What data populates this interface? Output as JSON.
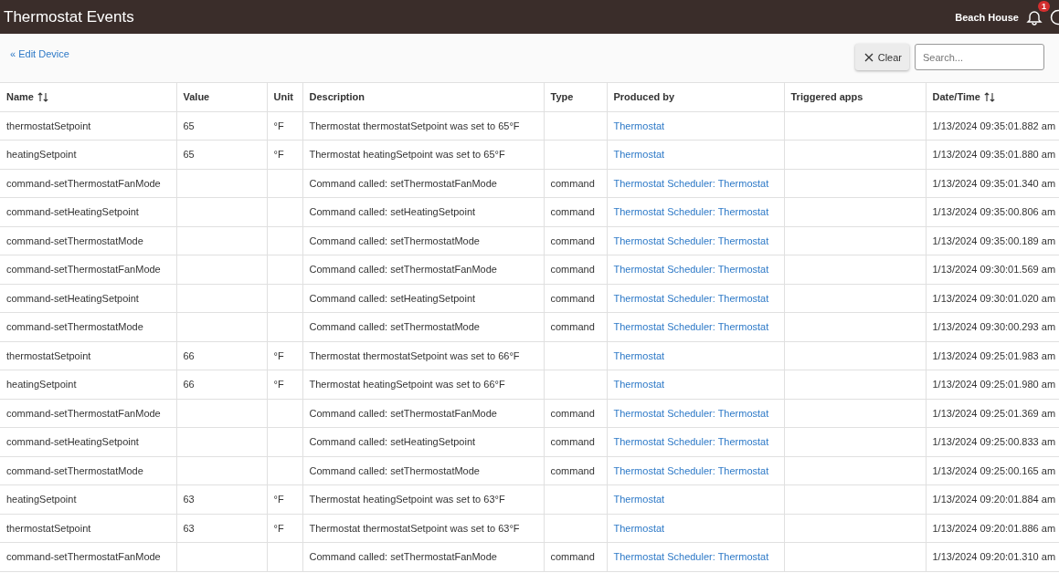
{
  "header": {
    "title": "Thermostat Events",
    "location": "Beach House",
    "notification_count": "1"
  },
  "toolbar": {
    "back_link": "« Edit Device",
    "clear_button": "Clear",
    "search": {
      "placeholder": "Search..."
    }
  },
  "table": {
    "columns": [
      {
        "label": "Name",
        "sortable": true
      },
      {
        "label": "Value",
        "sortable": false
      },
      {
        "label": "Unit",
        "sortable": false
      },
      {
        "label": "Description",
        "sortable": false
      },
      {
        "label": "Type",
        "sortable": false
      },
      {
        "label": "Produced by",
        "sortable": false
      },
      {
        "label": "Triggered apps",
        "sortable": false
      },
      {
        "label": "Date/Time",
        "sortable": true
      }
    ],
    "rows": [
      {
        "name": "thermostatSetpoint",
        "value": "65",
        "unit": "°F",
        "description": "Thermostat thermostatSetpoint was set to 65°F",
        "produced_by": "Thermostat",
        "date_time": "1/13/2024 09:35:01.882 am"
      },
      {
        "name": "heatingSetpoint",
        "value": "65",
        "unit": "°F",
        "description": "Thermostat heatingSetpoint was set to 65°F",
        "produced_by": "Thermostat",
        "date_time": "1/13/2024 09:35:01.880 am"
      },
      {
        "name": "command-setThermostatFanMode",
        "description": "Command called: setThermostatFanMode",
        "type": "command",
        "produced_by": "Thermostat Scheduler: Thermostat",
        "date_time": "1/13/2024 09:35:01.340 am"
      },
      {
        "name": "command-setHeatingSetpoint",
        "description": "Command called: setHeatingSetpoint",
        "type": "command",
        "produced_by": "Thermostat Scheduler: Thermostat",
        "date_time": "1/13/2024 09:35:00.806 am"
      },
      {
        "name": "command-setThermostatMode",
        "description": "Command called: setThermostatMode",
        "type": "command",
        "produced_by": "Thermostat Scheduler: Thermostat",
        "date_time": "1/13/2024 09:35:00.189 am"
      },
      {
        "name": "command-setThermostatFanMode",
        "description": "Command called: setThermostatFanMode",
        "type": "command",
        "produced_by": "Thermostat Scheduler: Thermostat",
        "date_time": "1/13/2024 09:30:01.569 am"
      },
      {
        "name": "command-setHeatingSetpoint",
        "description": "Command called: setHeatingSetpoint",
        "type": "command",
        "produced_by": "Thermostat Scheduler: Thermostat",
        "date_time": "1/13/2024 09:30:01.020 am"
      },
      {
        "name": "command-setThermostatMode",
        "description": "Command called: setThermostatMode",
        "type": "command",
        "produced_by": "Thermostat Scheduler: Thermostat",
        "date_time": "1/13/2024 09:30:00.293 am"
      },
      {
        "name": "thermostatSetpoint",
        "value": "66",
        "unit": "°F",
        "description": "Thermostat thermostatSetpoint was set to 66°F",
        "produced_by": "Thermostat",
        "date_time": "1/13/2024 09:25:01.983 am"
      },
      {
        "name": "heatingSetpoint",
        "value": "66",
        "unit": "°F",
        "description": "Thermostat heatingSetpoint was set to 66°F",
        "produced_by": "Thermostat",
        "date_time": "1/13/2024 09:25:01.980 am"
      },
      {
        "name": "command-setThermostatFanMode",
        "description": "Command called: setThermostatFanMode",
        "type": "command",
        "produced_by": "Thermostat Scheduler: Thermostat",
        "date_time": "1/13/2024 09:25:01.369 am"
      },
      {
        "name": "command-setHeatingSetpoint",
        "description": "Command called: setHeatingSetpoint",
        "type": "command",
        "produced_by": "Thermostat Scheduler: Thermostat",
        "date_time": "1/13/2024 09:25:00.833 am"
      },
      {
        "name": "command-setThermostatMode",
        "description": "Command called: setThermostatMode",
        "type": "command",
        "produced_by": "Thermostat Scheduler: Thermostat",
        "date_time": "1/13/2024 09:25:00.165 am"
      },
      {
        "name": "heatingSetpoint",
        "value": "63",
        "unit": "°F",
        "description": "Thermostat heatingSetpoint was set to 63°F",
        "produced_by": "Thermostat",
        "date_time": "1/13/2024 09:20:01.884 am"
      },
      {
        "name": "thermostatSetpoint",
        "value": "63",
        "unit": "°F",
        "description": "Thermostat thermostatSetpoint was set to 63°F",
        "produced_by": "Thermostat",
        "date_time": "1/13/2024 09:20:01.886 am"
      },
      {
        "name": "command-setThermostatFanMode",
        "description": "Command called: setThermostatFanMode",
        "type": "command",
        "produced_by": "Thermostat Scheduler: Thermostat",
        "date_time": "1/13/2024 09:20:01.310 am"
      }
    ]
  }
}
